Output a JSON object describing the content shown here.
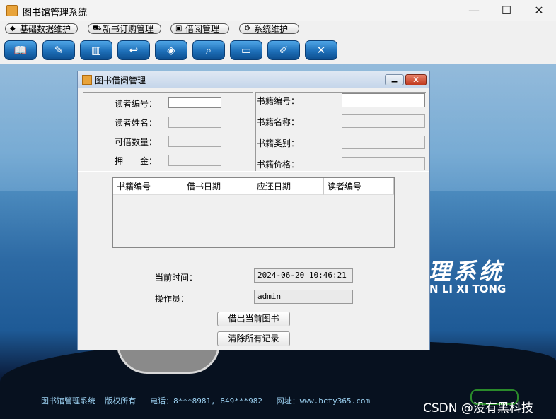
{
  "window": {
    "title": "图书馆管理系统",
    "minimize_glyph": "—",
    "maximize_glyph": "☐",
    "close_glyph": "✕"
  },
  "menu": [
    {
      "label": "基础数据维护",
      "icon": "cube-icon",
      "glyph": "◆"
    },
    {
      "label": "新书订购管理",
      "icon": "cart-icon",
      "glyph": "⛟"
    },
    {
      "label": "借阅管理",
      "icon": "lock-icon",
      "glyph": "▣"
    },
    {
      "label": "系统维护",
      "icon": "gears-icon",
      "glyph": "⚙"
    }
  ],
  "toolbar": [
    {
      "icon": "book-icon",
      "glyph": "📖"
    },
    {
      "icon": "edit-book-icon",
      "glyph": "✎"
    },
    {
      "icon": "books-icon",
      "glyph": "▥"
    },
    {
      "icon": "return-book-icon",
      "glyph": "↩"
    },
    {
      "icon": "box-icon",
      "glyph": "◈"
    },
    {
      "icon": "search-icon",
      "glyph": "⌕"
    },
    {
      "icon": "monitor-icon",
      "glyph": "▭"
    },
    {
      "icon": "edit-form-icon",
      "glyph": "✐"
    },
    {
      "icon": "exit-icon",
      "glyph": "✕"
    }
  ],
  "background": {
    "title": "理系统",
    "subtitle": "N LI XI TONG",
    "footer": "图书馆管理系统  版权所有   电话：8***8981, 849***982   网址：www.bcty365.com",
    "watermark": "CSDN @没有黑科技"
  },
  "dialog": {
    "title": "图书借阅管理",
    "reader": {
      "id_label": "读者编号：",
      "name_label": "读者姓名：",
      "quota_label": "可借数量：",
      "deposit_label": "押　　金：",
      "id_value": "",
      "name_value": "",
      "quota_value": "",
      "deposit_value": ""
    },
    "book": {
      "id_label": "书籍编号：",
      "name_label": "书籍名称：",
      "type_label": "书籍类别：",
      "price_label": "书籍价格：",
      "id_value": "",
      "name_value": "",
      "type_value": "",
      "price_value": ""
    },
    "table": {
      "columns": [
        "书籍编号",
        "借书日期",
        "应还日期",
        "读者编号"
      ],
      "rows": []
    },
    "time_label": "当前时间：",
    "time_value": "2024-06-20 10:46:21",
    "operator_label": "操作员：",
    "operator_value": "admin",
    "borrow_button": "借出当前图书",
    "clear_button": "清除所有记录"
  }
}
